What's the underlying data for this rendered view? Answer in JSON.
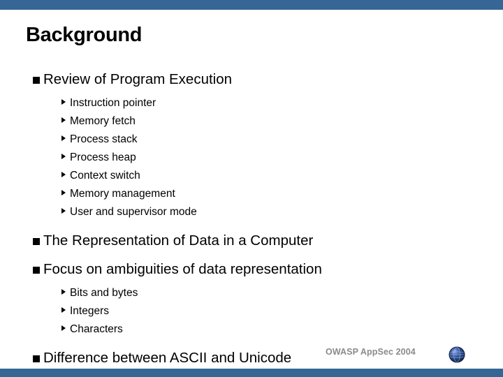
{
  "slide": {
    "title": "Background",
    "accent_color": "#366695",
    "text_color": "#000000",
    "background_color": "#ffffff"
  },
  "content": [
    {
      "level": 1,
      "text": "Review of Program Execution",
      "marker": "square-bullet"
    },
    {
      "level": 2,
      "text": "Instruction pointer",
      "marker": "triangle-bullet"
    },
    {
      "level": 2,
      "text": "Memory fetch",
      "marker": "triangle-bullet"
    },
    {
      "level": 2,
      "text": "Process stack",
      "marker": "triangle-bullet"
    },
    {
      "level": 2,
      "text": "Process heap",
      "marker": "triangle-bullet"
    },
    {
      "level": 2,
      "text": "Context switch",
      "marker": "triangle-bullet"
    },
    {
      "level": 2,
      "text": "Memory management",
      "marker": "triangle-bullet"
    },
    {
      "level": 2,
      "text": "User and supervisor mode",
      "marker": "triangle-bullet"
    },
    {
      "level": 1,
      "text": "The Representation of Data in a Computer",
      "marker": "square-bullet"
    },
    {
      "level": 1,
      "text": "Focus on ambiguities of data representation",
      "marker": "square-bullet"
    },
    {
      "level": 2,
      "text": "Bits and bytes",
      "marker": "triangle-bullet"
    },
    {
      "level": 2,
      "text": "Integers",
      "marker": "triangle-bullet"
    },
    {
      "level": 2,
      "text": "Characters",
      "marker": "triangle-bullet"
    },
    {
      "level": 1,
      "text": "Difference between ASCII and Unicode",
      "marker": "square-bullet"
    }
  ],
  "footer": {
    "label": "OWASP AppSec 2004",
    "label_color": "#8a8a8a",
    "logo": "owasp-globe-logo"
  }
}
